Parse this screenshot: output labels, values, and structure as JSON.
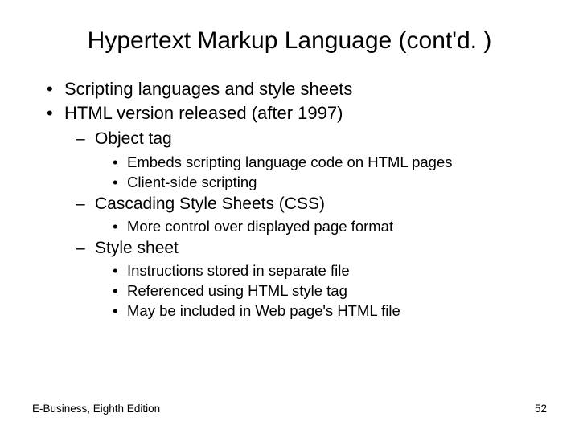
{
  "title": "Hypertext Markup Language (cont'd. )",
  "bullets": {
    "b1": "Scripting languages and style sheets",
    "b2": "HTML version released (after 1997)",
    "b2_1": "Object tag",
    "b2_1_1": "Embeds scripting language code on HTML pages",
    "b2_1_2": "Client-side scripting",
    "b2_2": "Cascading Style Sheets (CSS)",
    "b2_2_1": "More control over displayed page format",
    "b2_3": "Style sheet",
    "b2_3_1": "Instructions stored in separate file",
    "b2_3_2": "Referenced using HTML style tag",
    "b2_3_3": "May be included in Web page's HTML file"
  },
  "footer": {
    "left": "E-Business, Eighth Edition",
    "right": "52"
  }
}
